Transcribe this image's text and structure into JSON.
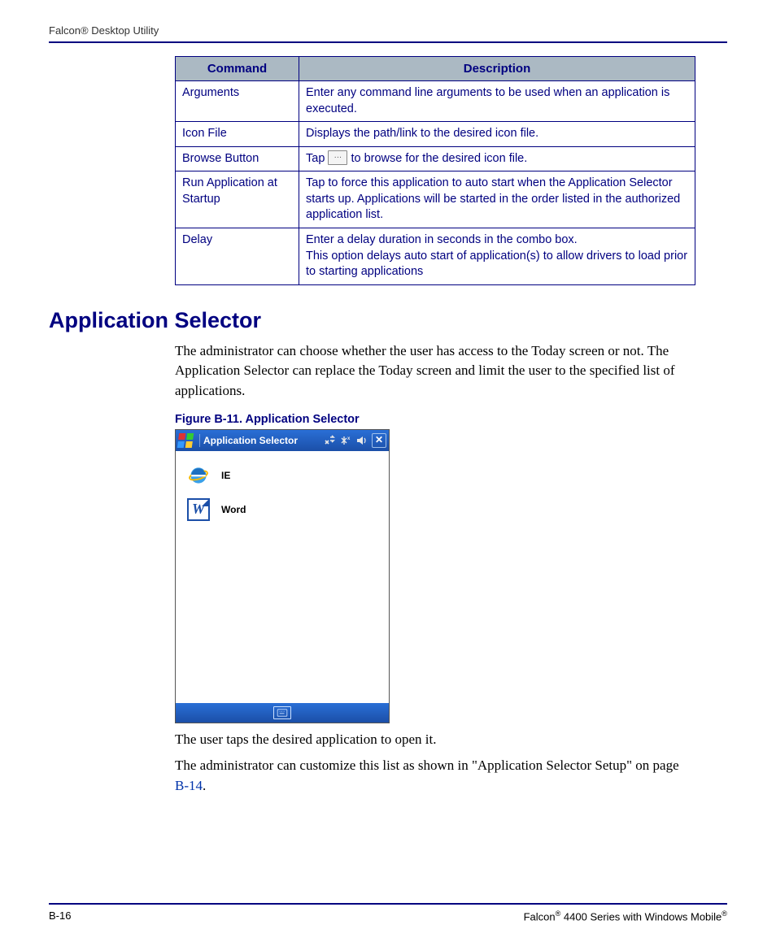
{
  "header": {
    "title": "Falcon® Desktop Utility"
  },
  "table": {
    "headers": {
      "col1": "Command",
      "col2": "Description"
    },
    "rows": [
      {
        "cmd": "Arguments",
        "desc": "Enter any command line arguments to be used when an application is executed."
      },
      {
        "cmd": "Icon File",
        "desc": "Displays the path/link to the desired icon file."
      },
      {
        "cmd": "Browse Button",
        "desc_pre": "Tap ",
        "desc_post": " to browse for the desired icon file."
      },
      {
        "cmd": "Run Application at Startup",
        "desc": "Tap to force this application to auto start when the Application Selector starts up. Applications will be started in the order listed in the authorized application list."
      },
      {
        "cmd": "Delay",
        "desc": "Enter a delay duration in seconds in the combo box.\nThis option delays auto start of application(s) to allow drivers to load prior to starting applications"
      }
    ]
  },
  "section": {
    "title": "Application Selector",
    "para1": "The administrator can choose whether the user has access to the Today screen or not. The Application Selector can replace the Today screen and limit the user to the specified list of applications.",
    "figure_caption": "Figure B-11. Application Selector",
    "para2": "The user taps the desired application to open it.",
    "para3_pre": "The administrator can customize this list as shown in \"Application Selector Setup\" on page ",
    "para3_link": "B-14",
    "para3_post": "."
  },
  "mobile": {
    "title": "Application Selector",
    "apps": [
      {
        "label": "IE"
      },
      {
        "label": "Word"
      }
    ]
  },
  "footer": {
    "left": "B-16",
    "right_pre": "Falcon",
    "right_mid": " 4400 Series with Windows Mobile"
  }
}
